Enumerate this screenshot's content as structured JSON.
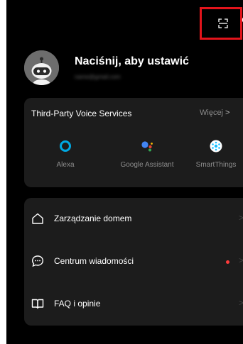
{
  "profile": {
    "title": "Naciśnij, aby ustawić",
    "email": "name@gmail.com"
  },
  "voice_services": {
    "title": "Third-Party Voice Services",
    "more_label": "Więcej",
    "more_chevron": ">",
    "items": [
      {
        "label": "Alexa",
        "icon": "alexa-icon"
      },
      {
        "label": "Google Assistant",
        "icon": "google-assistant-icon"
      },
      {
        "label": "SmartThings",
        "icon": "smartthings-icon"
      }
    ]
  },
  "menu": {
    "chevron": ">",
    "items": [
      {
        "label": "Zarządzanie domem",
        "icon": "home-icon"
      },
      {
        "label": "Centrum wiadomości",
        "icon": "message-icon",
        "has_notification": true
      },
      {
        "label": "FAQ i opinie",
        "icon": "book-icon"
      }
    ]
  },
  "colors": {
    "background": "#000000",
    "card": "#1c1c1c",
    "highlight_border": "#e3141b",
    "notification_dot": "#ff3b3b",
    "alexa": "#00a8e1",
    "smartthings": "#15bfff"
  },
  "top_icons": [
    "scan-icon",
    "settings-icon"
  ]
}
